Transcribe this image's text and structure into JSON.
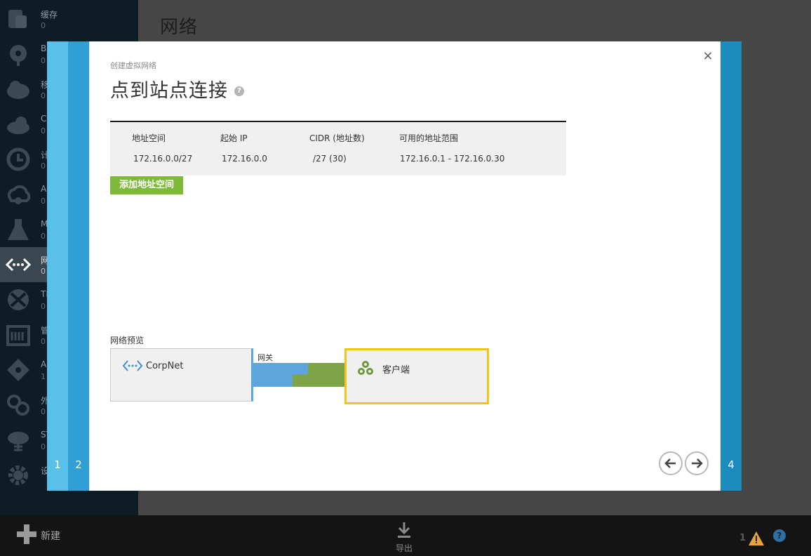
{
  "sidebar": {
    "items": [
      {
        "label": "缓存",
        "count": "0",
        "icon": "cache-icon"
      },
      {
        "label": "BI",
        "count": "0",
        "icon": "bi-icon"
      },
      {
        "label": "移",
        "count": "0",
        "icon": "mobile-cloud-icon"
      },
      {
        "label": "CI",
        "count": "0",
        "icon": "cloud-services-icon"
      },
      {
        "label": "计",
        "count": "0",
        "icon": "scheduler-icon"
      },
      {
        "label": "AI",
        "count": "0",
        "icon": "api-cloud-icon"
      },
      {
        "label": "M",
        "count": "0",
        "icon": "machine-learning-icon"
      },
      {
        "label": "网",
        "count": "0",
        "icon": "network-icon"
      },
      {
        "label": "TI",
        "count": "0",
        "icon": "traffic-manager-icon"
      },
      {
        "label": "管",
        "count": "0",
        "icon": "management-icon"
      },
      {
        "label": "A",
        "count": "1",
        "icon": "active-directory-icon"
      },
      {
        "label": "外",
        "count": "0",
        "icon": "marketplace-icon"
      },
      {
        "label": "ST",
        "count": "0",
        "icon": "storsimple-icon"
      },
      {
        "label": "设",
        "count": "",
        "icon": "settings-icon"
      }
    ]
  },
  "page": {
    "title": "网络"
  },
  "bottom_bar": {
    "new_label": "新建",
    "export_label": "导出",
    "alert_count": "1",
    "help": "?"
  },
  "wizard": {
    "steps": [
      "1",
      "2",
      "4"
    ],
    "close": "×",
    "subtitle": "创建虚拟网络",
    "title": "点到站点连接",
    "help": "?",
    "table": {
      "headers": [
        "地址空间",
        "起始 IP",
        "CIDR (地址数)",
        "可用的地址范围"
      ],
      "rows": [
        [
          "172.16.0.0/27",
          "172.16.0.0",
          "/27 (30)",
          "172.16.0.1 - 172.16.0.30"
        ]
      ]
    },
    "add_button": "添加地址空间",
    "preview": {
      "label": "网络预览",
      "network_name": "CorpNet",
      "gateway_label": "网关",
      "client_label": "客户端"
    },
    "colors": {
      "step1": "#59c0ea",
      "step2": "#2f9fd4",
      "step4": "#1c8bbd",
      "accent_green": "#7eb93a",
      "gateway_blue": "#5ca5dd",
      "client_border": "#f0c419"
    }
  }
}
